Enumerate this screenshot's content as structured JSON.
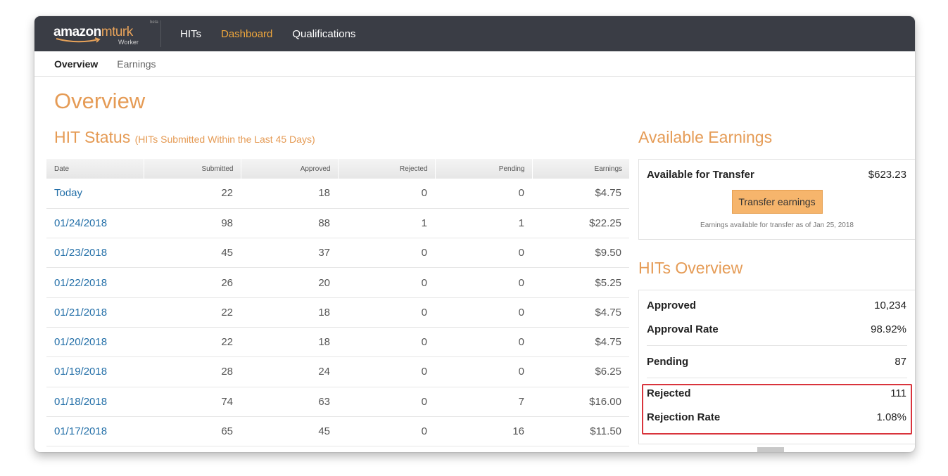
{
  "header": {
    "logo": {
      "brand_main": "amazon",
      "brand_accent": "mturk",
      "beta": "beta",
      "sub": "Worker"
    },
    "nav": [
      "HITs",
      "Dashboard",
      "Qualifications"
    ],
    "active_nav": "Dashboard"
  },
  "subnav": {
    "items": [
      "Overview",
      "Earnings"
    ],
    "active": "Overview"
  },
  "page_title": "Overview",
  "hit_status": {
    "title": "HIT Status",
    "subtitle": "(HITs Submitted Within the Last 45 Days)",
    "columns": [
      "Date",
      "Submitted",
      "Approved",
      "Rejected",
      "Pending",
      "Earnings"
    ],
    "rows": [
      [
        "Today",
        "22",
        "18",
        "0",
        "0",
        "$4.75"
      ],
      [
        "01/24/2018",
        "98",
        "88",
        "1",
        "1",
        "$22.25"
      ],
      [
        "01/23/2018",
        "45",
        "37",
        "0",
        "0",
        "$9.50"
      ],
      [
        "01/22/2018",
        "26",
        "20",
        "0",
        "0",
        "$5.25"
      ],
      [
        "01/21/2018",
        "22",
        "18",
        "0",
        "0",
        "$4.75"
      ],
      [
        "01/20/2018",
        "22",
        "18",
        "0",
        "0",
        "$4.75"
      ],
      [
        "01/19/2018",
        "28",
        "24",
        "0",
        "0",
        "$6.25"
      ],
      [
        "01/18/2018",
        "74",
        "63",
        "0",
        "7",
        "$16.00"
      ],
      [
        "01/17/2018",
        "65",
        "45",
        "0",
        "16",
        "$11.50"
      ]
    ]
  },
  "available_earnings": {
    "title": "Available Earnings",
    "label": "Available for Transfer",
    "amount": "$623.23",
    "button_label": "Transfer earnings",
    "note": "Earnings available for transfer as of Jan 25, 2018"
  },
  "hits_overview": {
    "title": "HITs Overview",
    "approved_label": "Approved",
    "approved_value": "10,234",
    "approval_rate_label": "Approval Rate",
    "approval_rate_value": "98.92%",
    "pending_label": "Pending",
    "pending_value": "87",
    "rejected_label": "Rejected",
    "rejected_value": "111",
    "rejection_rate_label": "Rejection Rate",
    "rejection_rate_value": "1.08%"
  },
  "colors": {
    "accent": "#e59b55",
    "nav_active": "#f0a73c",
    "link": "#236fa8",
    "highlight": "#d9343c",
    "topbar": "#3a3d45"
  }
}
